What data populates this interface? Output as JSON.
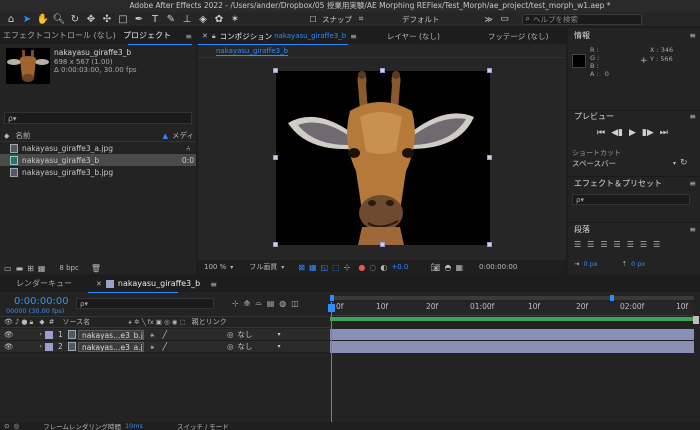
{
  "app": {
    "title": "Adobe After Effects 2022 - /Users/ander/Dropbox/05 授業用実験/AE Morphing REFlex/Test_Morph/ae_project/test_morph_w1.aep *",
    "snap_label": "スナップ",
    "workspace_label": "デフォルト",
    "search_placeholder": "ヘルプを検索"
  },
  "project_panel": {
    "tab_effects": "エフェクトコントロール (なし)",
    "tab_project": "プロジェクト",
    "preview_name": "nakayasu_giraffe3_b",
    "preview_size": "698 x 567 (1.00)",
    "preview_duration": "Δ 0:00:03:00, 30.00 fps",
    "search_placeholder": "ρ▾",
    "col_name": "名前",
    "col_media": "メディ",
    "items": [
      {
        "name": "nakayasu_giraffe3_a.jpg",
        "type": "image",
        "extra": ""
      },
      {
        "name": "nakayasu_giraffe3_b",
        "type": "comp",
        "extra": "0:0"
      },
      {
        "name": "nakayasu_giraffe3_b.jpg",
        "type": "image",
        "extra": ""
      }
    ],
    "bpc": "8 bpc"
  },
  "comp_panel": {
    "tab_comp_prefix": "コンポジション",
    "tab_comp_name": "nakayasu_giraffe3_b",
    "tab_layer": "レイヤー (なし)",
    "tab_footage": "フッテージ (なし)",
    "subtab": "nakayasu_giraffe3_b",
    "zoom": "100 %",
    "quality": "フル画質",
    "exposure": "+0.0",
    "timecode": "0:00:00:00"
  },
  "info_panel": {
    "title": "情報",
    "r_label": "R :",
    "g_label": "G :",
    "b_label": "B :",
    "a_label": "A :",
    "a_value": "0",
    "x_readout": "X : 346",
    "y_readout": "Y : 566"
  },
  "preview_panel": {
    "title": "プレビュー",
    "shortcut_label": "ショートカット",
    "shortcut_value": "スペースバー"
  },
  "effects_panel": {
    "title": "エフェクト＆プリセット",
    "search_placeholder": "ρ▾"
  },
  "paragraph_panel": {
    "title": "段落",
    "indent_left": "0 px",
    "indent_right": "0 px",
    "indent_first": "0 px",
    "space_before": "0 px",
    "space_after": "0 px"
  },
  "timeline": {
    "tab_render": "レンダーキュー",
    "tab_comp": "nakayasu_giraffe3_b",
    "timecode": "0:00:00:00",
    "frames_fps": "00000 (30.00 fps)",
    "col_source": "ソース名",
    "col_parent": "親とリンク",
    "ruler": [
      "0f",
      "10f",
      "20f",
      "01:00f",
      "10f",
      "20f",
      "02:00f",
      "10f"
    ],
    "layers": [
      {
        "num": "1",
        "name": "nakayas…e3_b.jpg",
        "parent": "なし"
      },
      {
        "num": "2",
        "name": "nakayas…e3_a.jpg",
        "parent": "なし"
      }
    ],
    "footer_render_time": "フレームレンダリング時間",
    "footer_ms": "10ms",
    "footer_switch": "スイッチ / モード"
  },
  "colors": {
    "accent": "#2f8cff",
    "label_lavender": "#9a9fcf",
    "work_area_green": "#3aa55a",
    "layer_bar": "#8a8fb8"
  }
}
